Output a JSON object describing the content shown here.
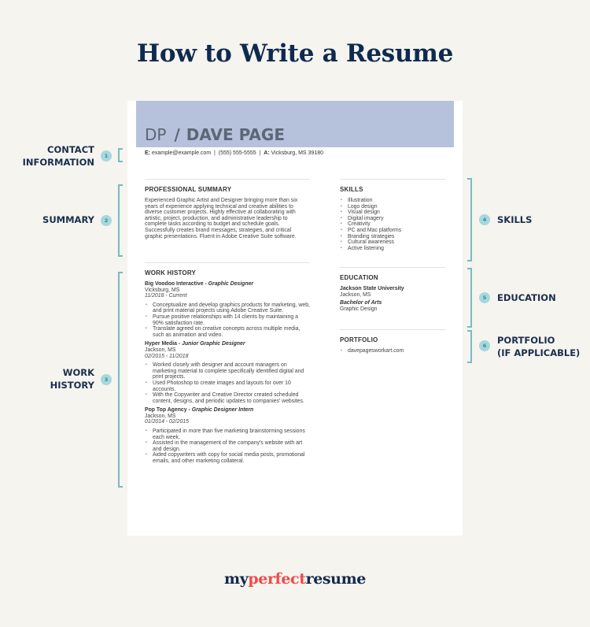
{
  "title": "How to Write a Resume",
  "colors": {
    "background": "#f5f4ef",
    "title": "#0f2a4f",
    "header_band": "#b6c1dc",
    "accent_teal": "#77bcc4",
    "badge_fill": "#a8d7de",
    "logo_accent": "#f04a4a"
  },
  "resume": {
    "initials": "DP",
    "separator": "/",
    "name": "DAVE PAGE",
    "contact": {
      "email_label": "E:",
      "email": "example@example.com",
      "divider": "|",
      "phone": "(555) 555-5555",
      "address_label": "A:",
      "address": "Vicksburg, MS 39180"
    },
    "summary": {
      "heading": "PROFESSIONAL SUMMARY",
      "text": "Experienced Graphic Artist and Designer bringing more than six years of experience applying technical and creative abilities to diverse customer projects. Highly effective at collaborating with artistic, project, production, and administrative leadership to complete tasks according to budget and schedule goals. Successfully creates brand messages, strategies, and critical graphic presentations. Fluent in Adobe Creative Suite software."
    },
    "work": {
      "heading": "WORK HISTORY",
      "jobs": [
        {
          "company": "Big Voodoo Interactive",
          "dash": " - ",
          "role": "Graphic Designer",
          "location": "Vicksburg, MS",
          "dates": "11/2018 - Current",
          "bullets": [
            "Conceptualize and develop graphics products for marketing, web, and print material projects using Adobe Creative Suite.",
            "Pursue positive relationships with 14 clients by maintaining a 90% satisfaction rate.",
            "Translate agreed on creative concepts across multiple media, such as animation and video."
          ]
        },
        {
          "company": "Hyper Media",
          "dash": " - ",
          "role": "Junior Graphic Designer",
          "location": "Jackson, MS",
          "dates": "02/2015 - 11/2018",
          "bullets": [
            "Worked closely with designer and account managers on marketing material to complete specifically identified digital and print projects.",
            "Used Photoshop to create images and layouts for over 10 accounts.",
            "With the Copywriter and Creative Director created scheduled content, designs, and periodic updates to companies' websites."
          ]
        },
        {
          "company": "Pop Top Agency",
          "dash": " - ",
          "role": "Graphic Designer Intern",
          "location": "Jackson, MS",
          "dates": "01/2014 - 02/2015",
          "bullets": [
            "Participated in more than five marketing brainstorming sessions each week.",
            "Assisted in the management of the company's website with art and design.",
            "Aided copywriters with copy for social media posts, promotional emails, and other marketing collateral."
          ]
        }
      ]
    },
    "skills": {
      "heading": "SKILLS",
      "items": [
        "Illustration",
        "Logo design",
        "Visual design",
        "Digital imagery",
        "Creativity",
        "PC and Mac platforms",
        "Branding strategies",
        "Cultural awareness",
        "Active listening"
      ]
    },
    "education": {
      "heading": "EDUCATION",
      "school": "Jackson State University",
      "location": "Jackson, MS",
      "degree": "Bachelor of Arts",
      "field": "Graphic Design"
    },
    "portfolio": {
      "heading": "PORTFOLIO",
      "items": [
        "davepagesworkart.com"
      ]
    }
  },
  "annotations": [
    {
      "number": "1",
      "line1": "CONTACT",
      "line2": "INFORMATION"
    },
    {
      "number": "2",
      "line1": "SUMMARY",
      "line2": ""
    },
    {
      "number": "3",
      "line1": "WORK",
      "line2": "HISTORY"
    },
    {
      "number": "4",
      "line1": "SKILLS",
      "line2": ""
    },
    {
      "number": "5",
      "line1": "EDUCATION",
      "line2": ""
    },
    {
      "number": "6",
      "line1": "PORTFOLIO",
      "line2": "(IF APPLICABLE)"
    }
  ],
  "logo": {
    "part1": "my",
    "part2": "perfect",
    "part3": "resume"
  }
}
